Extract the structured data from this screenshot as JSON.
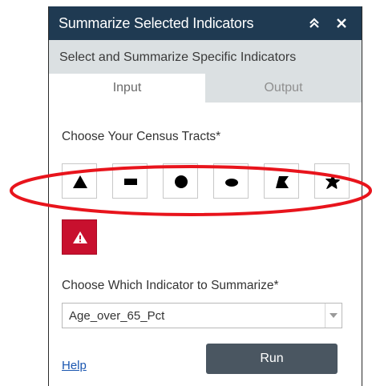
{
  "window": {
    "title": "Summarize Selected Indicators"
  },
  "subtitle": "Select and Summarize Specific Indicators",
  "tabs": [
    {
      "label": "Input",
      "active": true
    },
    {
      "label": "Output",
      "active": false
    }
  ],
  "census": {
    "label": "Choose Your Census Tracts*",
    "tools": [
      {
        "name": "triangle-icon",
        "shape": "triangle"
      },
      {
        "name": "rectangle-icon",
        "shape": "rectangle"
      },
      {
        "name": "circle-icon",
        "shape": "circle"
      },
      {
        "name": "ellipse-icon",
        "shape": "ellipse"
      },
      {
        "name": "polygon-icon",
        "shape": "polygon"
      },
      {
        "name": "freehand-polygon-icon",
        "shape": "freehand"
      }
    ],
    "clear_icon": "warning-icon"
  },
  "indicator": {
    "label": "Choose Which Indicator to Summarize*",
    "selected": "Age_over_65_Pct"
  },
  "footer": {
    "help_label": "Help",
    "run_label": "Run"
  },
  "colors": {
    "titlebar": "#1f3a52",
    "subtitle_bg": "#dbe0e2",
    "clear_button": "#c8102e",
    "run_button": "#4a5661",
    "link": "#1a56b0",
    "annotation_ring": "#e8141c"
  }
}
